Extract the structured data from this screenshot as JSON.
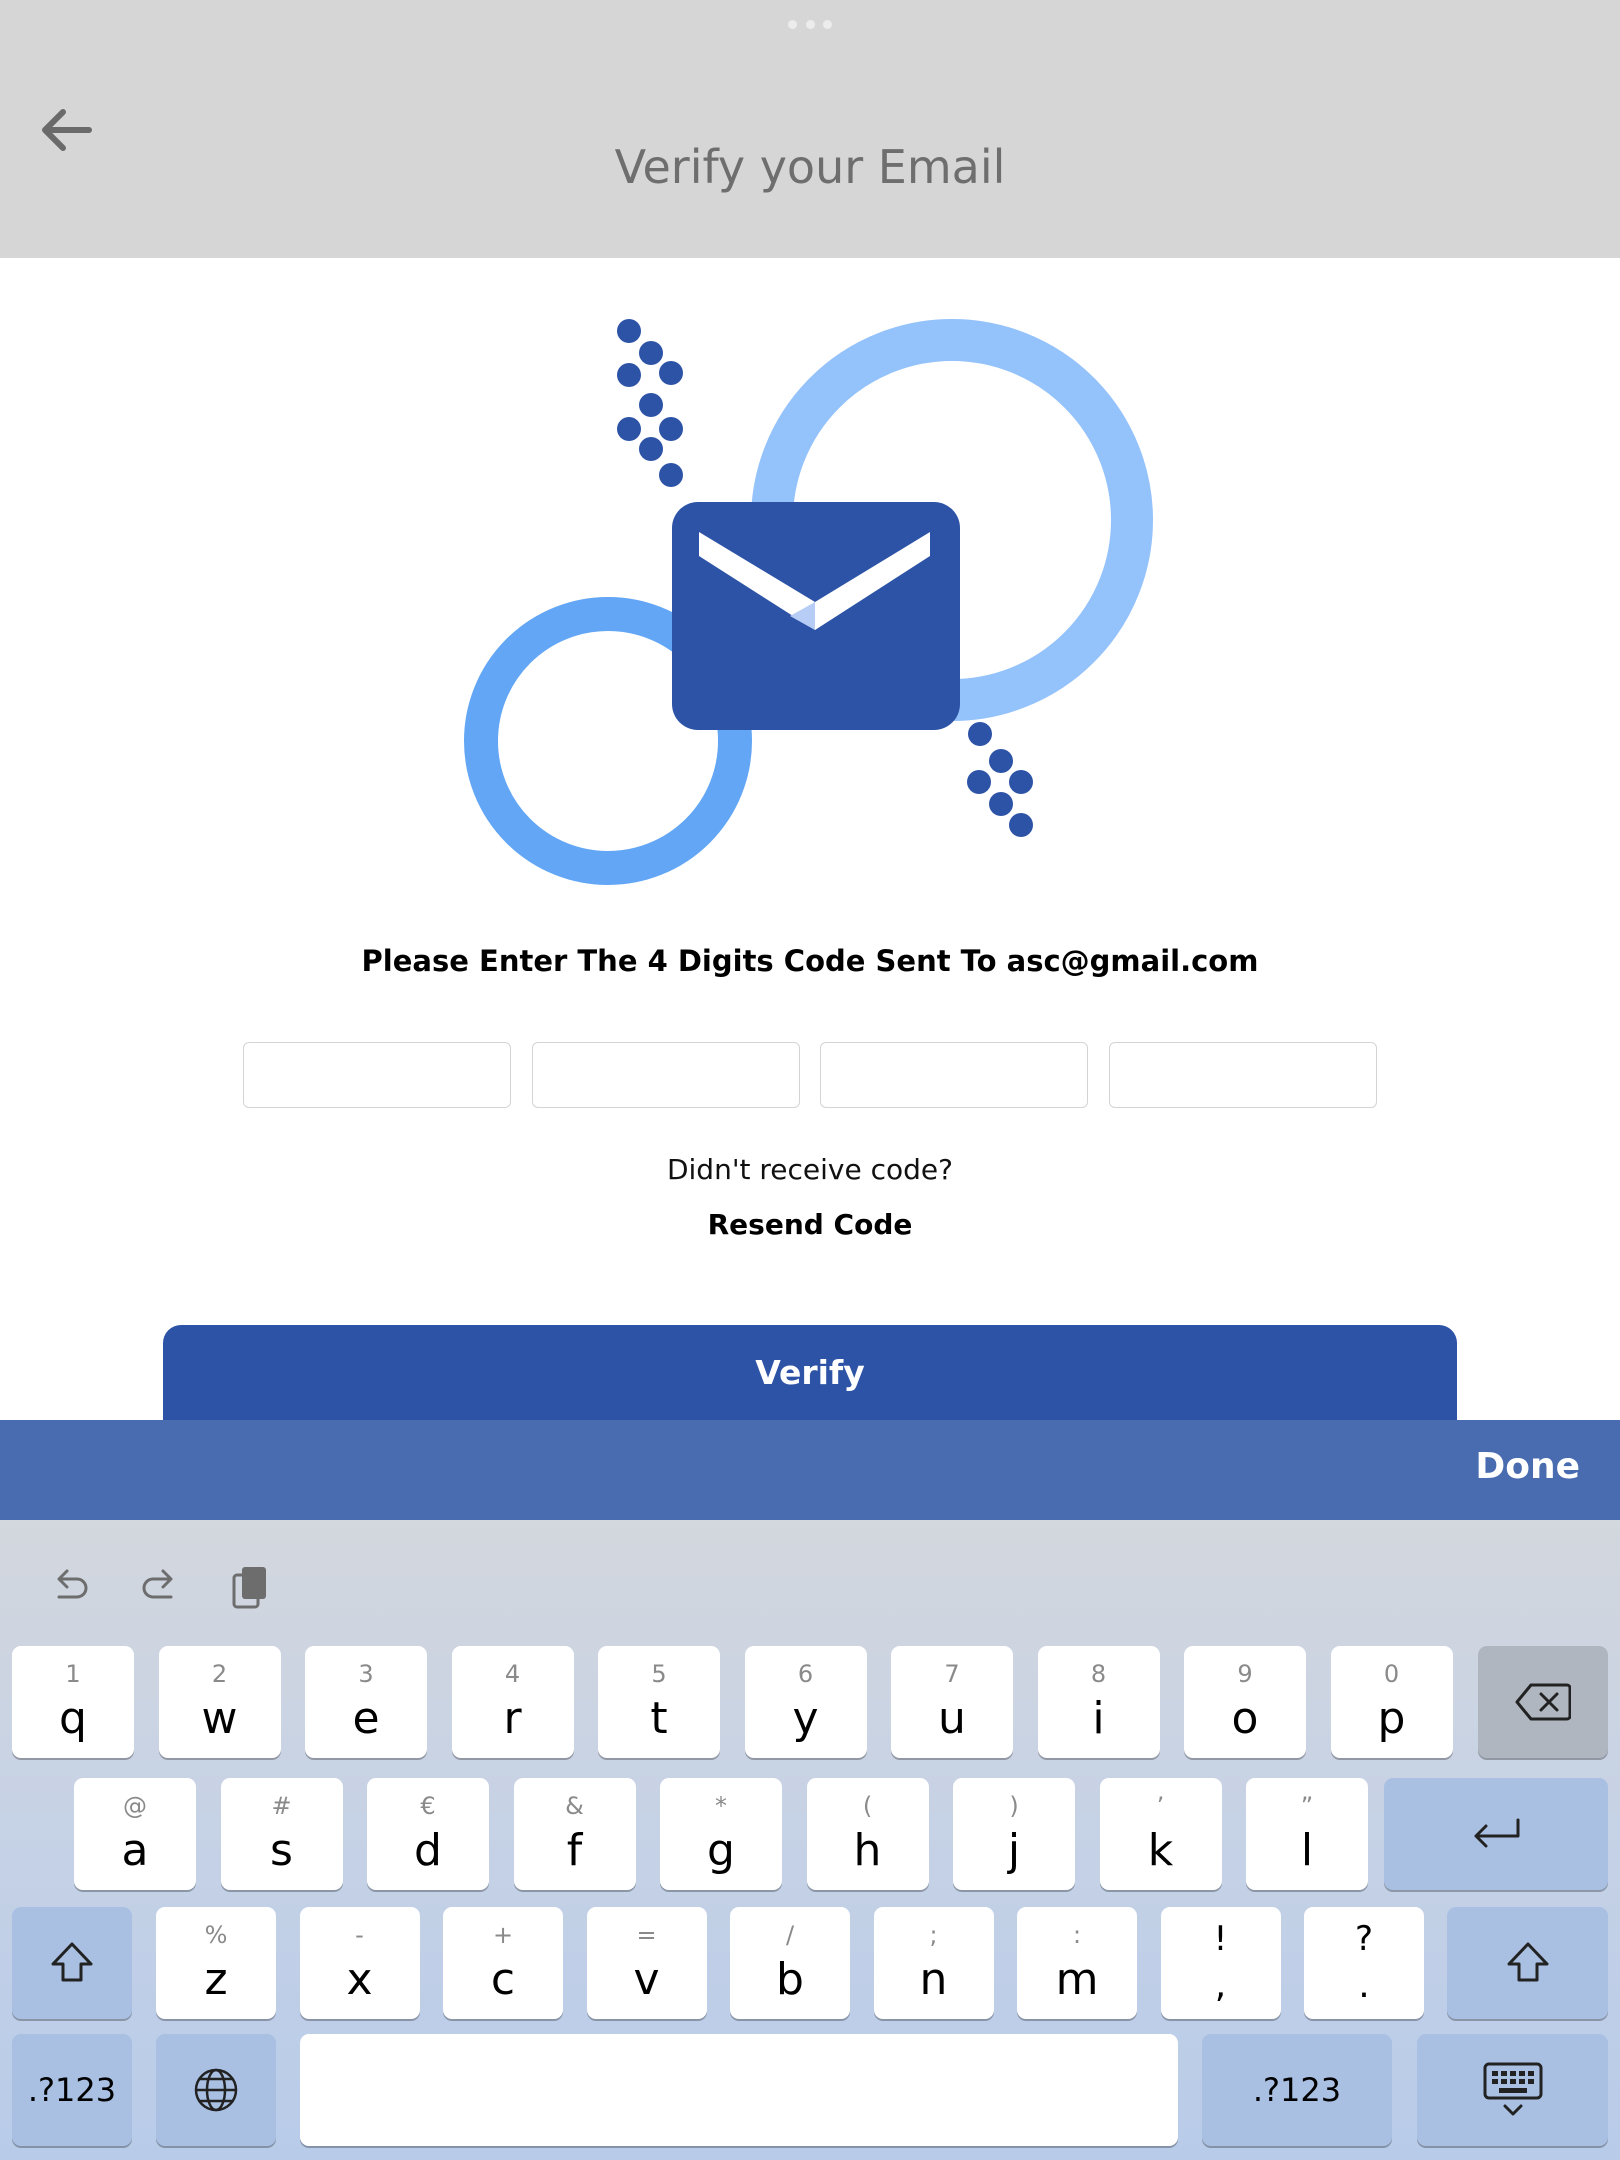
{
  "header": {
    "title": "Verify your Email"
  },
  "prompt": "Please Enter The 4 Digits Code Sent To asc@gmail.com",
  "code_inputs": [
    "",
    "",
    "",
    ""
  ],
  "resend": {
    "question": "Didn't receive code?",
    "link": "Resend Code"
  },
  "verify_label": "Verify",
  "done_label": "Done",
  "keyboard": {
    "row1": [
      {
        "sub": "1",
        "main": "q"
      },
      {
        "sub": "2",
        "main": "w"
      },
      {
        "sub": "3",
        "main": "e"
      },
      {
        "sub": "4",
        "main": "r"
      },
      {
        "sub": "5",
        "main": "t"
      },
      {
        "sub": "6",
        "main": "y"
      },
      {
        "sub": "7",
        "main": "u"
      },
      {
        "sub": "8",
        "main": "i"
      },
      {
        "sub": "9",
        "main": "o"
      },
      {
        "sub": "0",
        "main": "p"
      }
    ],
    "row2": [
      {
        "sub": "@",
        "main": "a"
      },
      {
        "sub": "#",
        "main": "s"
      },
      {
        "sub": "€",
        "main": "d"
      },
      {
        "sub": "&",
        "main": "f"
      },
      {
        "sub": "*",
        "main": "g"
      },
      {
        "sub": "(",
        "main": "h"
      },
      {
        "sub": ")",
        "main": "j"
      },
      {
        "sub": "’",
        "main": "k"
      },
      {
        "sub": "”",
        "main": "l"
      }
    ],
    "row3": [
      {
        "sub": "%",
        "main": "z"
      },
      {
        "sub": "-",
        "main": "x"
      },
      {
        "sub": "+",
        "main": "c"
      },
      {
        "sub": "=",
        "main": "v"
      },
      {
        "sub": "/",
        "main": "b"
      },
      {
        "sub": ";",
        "main": "n"
      },
      {
        "sub": ":",
        "main": "m"
      },
      {
        "sub": "!",
        "main": ","
      },
      {
        "sub": "?",
        "main": "."
      }
    ],
    "numbers_label": ".?123",
    "icons": {
      "undo": "undo-icon",
      "redo": "redo-icon",
      "paste": "clipboard-icon",
      "backspace": "backspace-icon",
      "return": "return-icon",
      "shift": "shift-icon",
      "globe": "globe-icon",
      "hide": "keyboard-dismiss-icon"
    }
  },
  "colors": {
    "header_bg": "#d6d6d6",
    "primary": "#2d53a7",
    "done_bar": "#496bb0",
    "ring_light": "#94c2fb",
    "ring_mid": "#62a6f5"
  }
}
